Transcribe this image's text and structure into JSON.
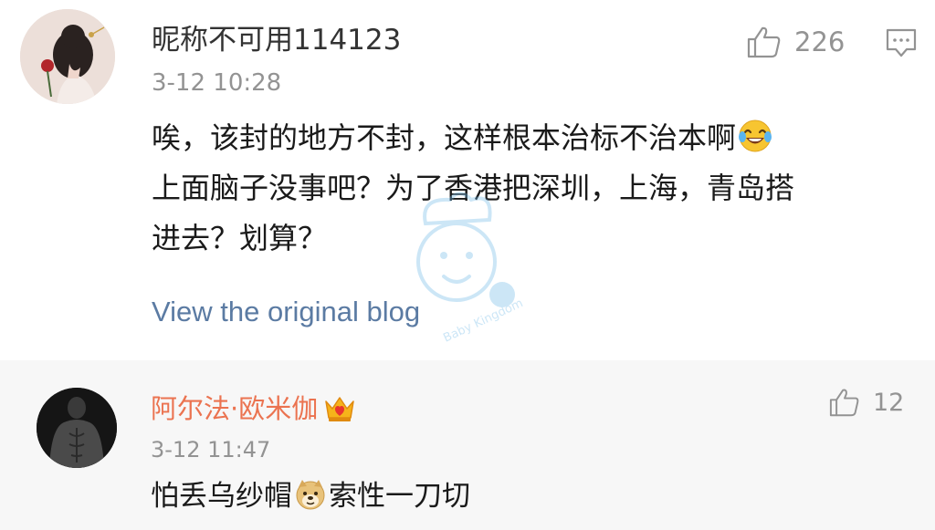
{
  "comment": {
    "username": "昵称不可用114123",
    "timestamp": "3-12 10:28",
    "text_line_1": "唉，该封的地方不封，这样根本治标不治本啊",
    "text_line_2": "上面脑子没事吧？为了香港把深圳，上海，青岛搭",
    "text_line_3": "进去？划算？",
    "like_count": "226",
    "view_blog_label": "View the original blog",
    "emoji_icon": "laughing-tears-emoji"
  },
  "reply": {
    "username": "阿尔法·欧米伽",
    "timestamp": "3-12 11:47",
    "text_before": "怕丢乌纱帽",
    "text_after": "索性一刀切",
    "like_count": "12",
    "emoji_icon": "doge-emoji",
    "badge_icon": "crown-icon"
  },
  "watermark": {
    "brand": "Baby Kingdom"
  },
  "colors": {
    "reply_username": "#eb7350",
    "link": "#5b7ba3",
    "meta": "#939393",
    "reply_bg": "#f7f7f7"
  }
}
